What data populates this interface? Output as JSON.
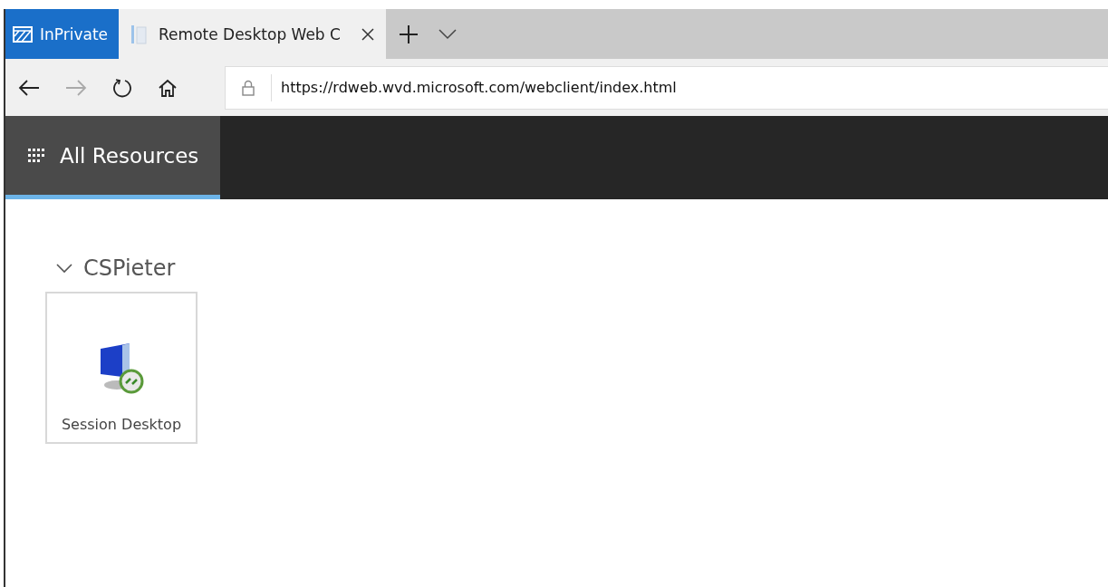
{
  "browser": {
    "inprivate_label": "InPrivate",
    "tabs": [
      {
        "title": "Remote Desktop Web C",
        "selected": true
      }
    ],
    "url": "https://rdweb.wvd.microsoft.com/webclient/index.html"
  },
  "nav": {
    "items": [
      {
        "label": "All Resources",
        "selected": true
      }
    ]
  },
  "groups": [
    {
      "title": "CSPieter",
      "expanded": true,
      "resources": [
        {
          "name": "Session Desktop"
        }
      ]
    }
  ]
}
